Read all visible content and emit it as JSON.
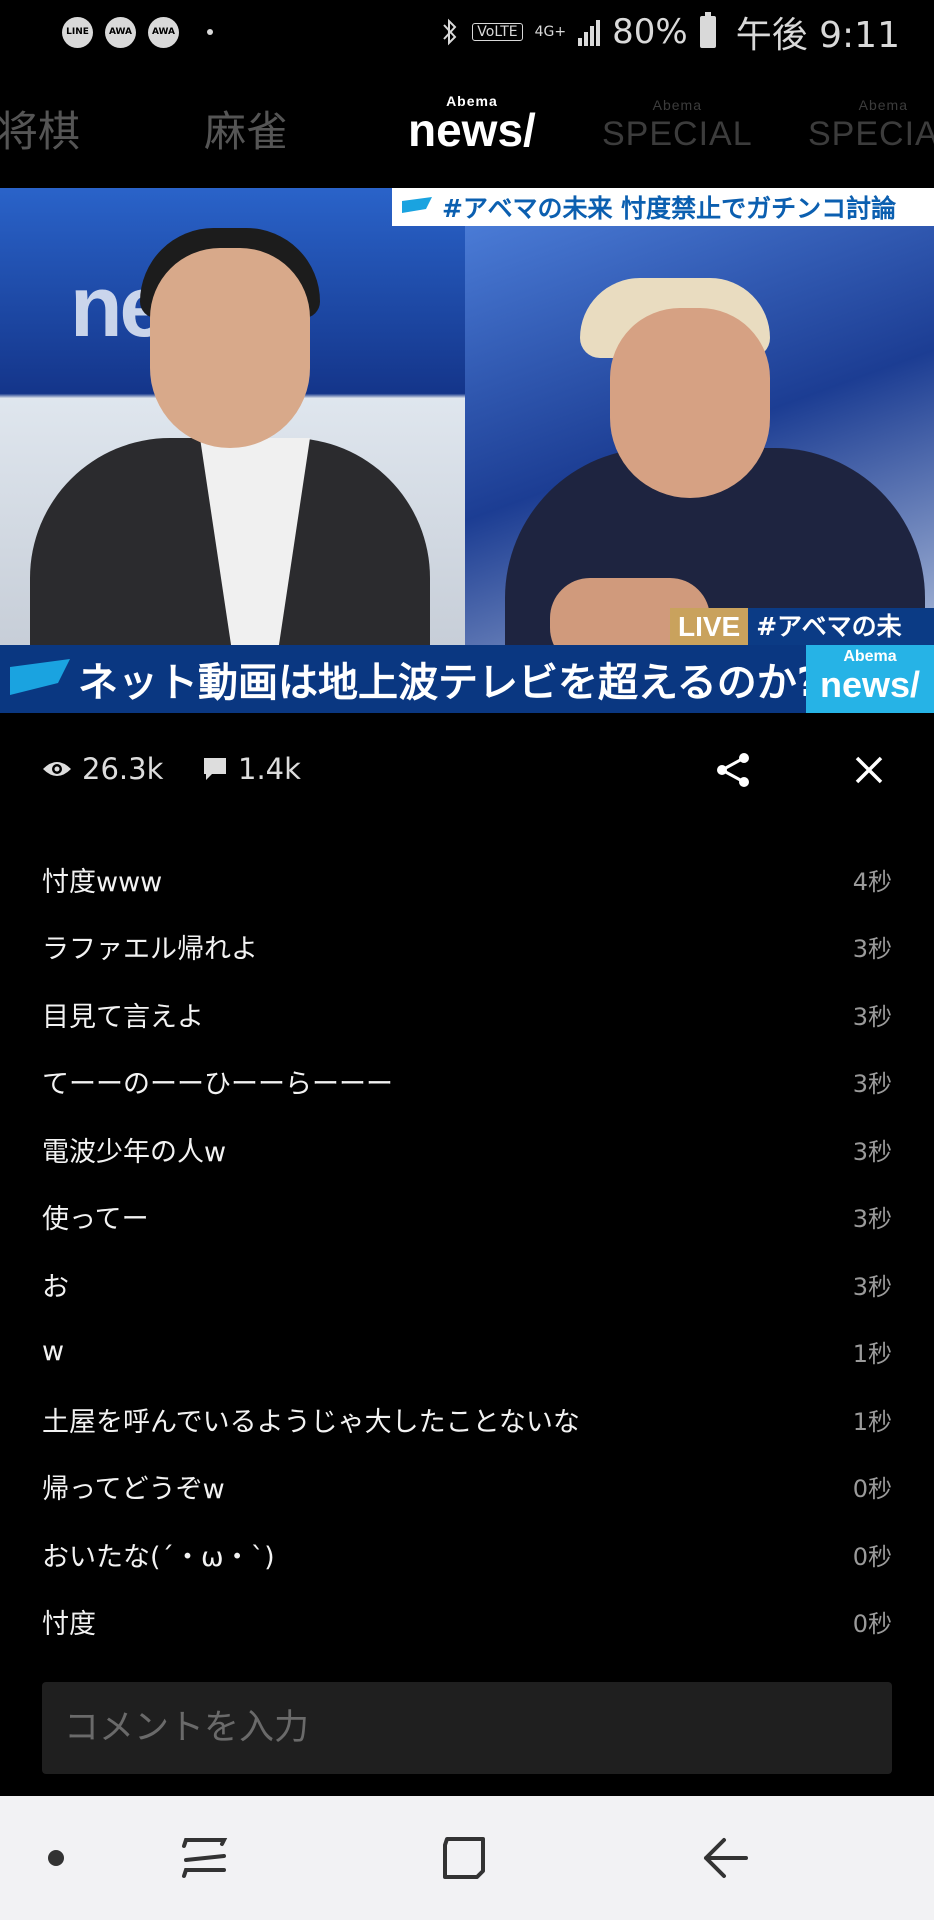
{
  "status_bar": {
    "notification_icons": [
      "LINE",
      "AWA",
      "AWA"
    ],
    "network_label": "4G+",
    "volte_label": "VoLTE",
    "battery": "80%",
    "time": "午後 9:11"
  },
  "channels": [
    {
      "label": "将棋"
    },
    {
      "label": "麻雀"
    },
    {
      "label_sub": "Abema",
      "label_main": "news/"
    },
    {
      "label_sub": "Abema",
      "label_main": "SPECIAL"
    },
    {
      "label_sub": "Abema",
      "label_main": "SPECIAL"
    }
  ],
  "video": {
    "top_ticker": "#アベマの未来 忖度禁止でガチンコ討論",
    "background_logo": "news",
    "live_label": "LIVE",
    "live_tag": "#アベマの未来",
    "headline": "ネット動画は地上波テレビを超えるのか?",
    "logo_sub": "Abema",
    "logo_main": "news/"
  },
  "stats": {
    "views": "26.3k",
    "comments": "1.4k"
  },
  "comments": [
    {
      "text": "忖度www",
      "time": "4秒"
    },
    {
      "text": "ラファエル帰れよ",
      "time": "3秒"
    },
    {
      "text": "目見て言えよ",
      "time": "3秒"
    },
    {
      "text": "てーーのーーひーーらーーー",
      "time": "3秒"
    },
    {
      "text": "電波少年の人w",
      "time": "3秒"
    },
    {
      "text": "使ってー",
      "time": "3秒"
    },
    {
      "text": "お",
      "time": "3秒"
    },
    {
      "text": "w",
      "time": "1秒"
    },
    {
      "text": "土屋を呼んでいるようじゃ大したことないな",
      "time": "1秒"
    },
    {
      "text": "帰ってどうぞw",
      "time": "0秒"
    },
    {
      "text": "おいたな(´・ω・`)",
      "time": "0秒"
    },
    {
      "text": "忖度",
      "time": "0秒"
    }
  ],
  "comment_input": {
    "placeholder": "コメントを入力"
  },
  "colors": {
    "background": "#000000",
    "headline_bar": "#0a3781",
    "accent_blue": "#26b3e6",
    "nav_bar": "#f2f2f4"
  }
}
